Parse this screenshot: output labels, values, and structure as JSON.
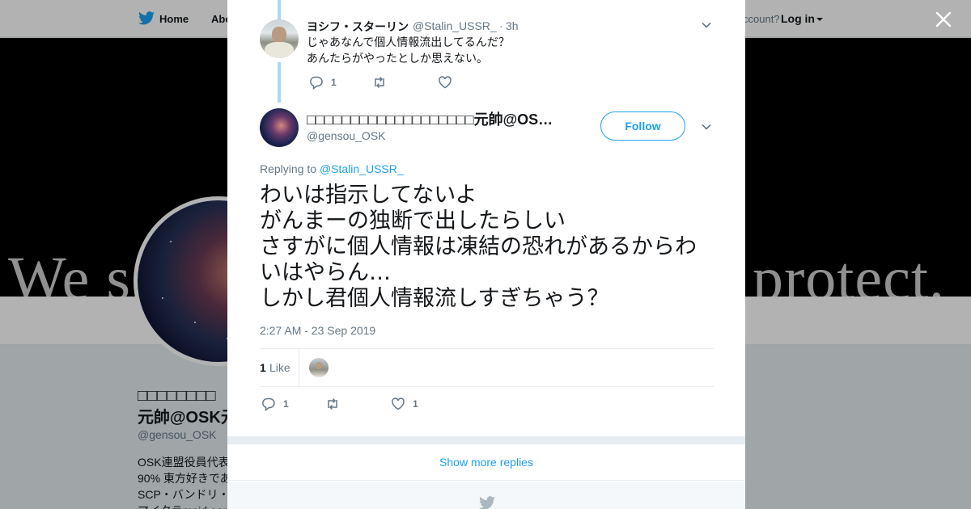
{
  "topnav": {
    "home_label": "Home",
    "about_label": "Abo",
    "account_prompt": "ccount?",
    "login_label": "Log in"
  },
  "banner": {
    "text_left": "We s",
    "text_right": "protect."
  },
  "profile": {
    "name_line1": "□□□□□□□□",
    "name_line2": "元帥@OSK元",
    "handle": "@gensou_OSK",
    "bio_lines": [
      "OSK連盟役員代表",
      "90% 東方好きであ",
      "SCP・バンドリ・",
      "マイクラmaid oor"
    ]
  },
  "modal": {
    "reply": {
      "name": "ヨシフ・スターリン",
      "handle": "@Stalin_USSR_",
      "separator": "·",
      "time": "3h",
      "text": "じゃあなんで個人情報流出してるんだ？\nあんたらがやったとしか思えない。",
      "reply_count": "1",
      "retweet_count": "",
      "like_count": ""
    },
    "tweet": {
      "name": "□□□□□□□□□□□□□□□□□□□元帥@OS…",
      "handle": "@gensou_OSK",
      "follow_label": "Follow",
      "replying_prefix": "Replying to",
      "replying_to": "@Stalin_USSR_",
      "text_lines": [
        "わいは指示してないよ",
        "がんまーの独断で出したらしい",
        "さすがに個人情報は凍結の恐れがあるからわ",
        "いはやらん…",
        "しかし君個人情報流しすぎちゃう？"
      ],
      "timestamp": "2:27 AM - 23 Sep 2019",
      "likes_count": "1",
      "likes_label": "Like",
      "reply_count": "1",
      "retweet_count": "",
      "like_count": "1"
    },
    "show_more_label": "Show more replies"
  },
  "colors": {
    "twitter_blue": "#1da1f2",
    "thread_line": "#a9d8f6",
    "secondary_text": "#657786",
    "primary_text": "#14171a",
    "page_bg": "#e6ecf0"
  },
  "icons": [
    "twitter-bird-icon",
    "close-icon",
    "chevron-down-icon",
    "reply-icon",
    "retweet-icon",
    "heart-icon",
    "caret-down-icon"
  ]
}
